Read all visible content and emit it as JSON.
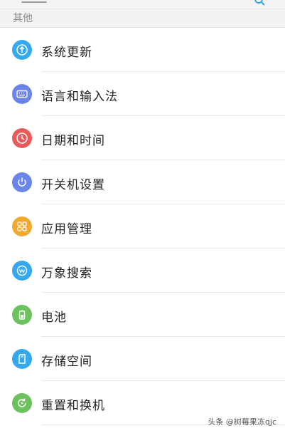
{
  "section": {
    "title": "其他"
  },
  "items": [
    {
      "label": "系统更新",
      "icon": "update-arrow-icon",
      "color": "#36a8ee"
    },
    {
      "label": "语言和输入法",
      "icon": "keyboard-icon",
      "color": "#6b86e8"
    },
    {
      "label": "日期和时间",
      "icon": "clock-icon",
      "color": "#ea5a5a"
    },
    {
      "label": "开关机设置",
      "icon": "power-icon",
      "color": "#6b86e8"
    },
    {
      "label": "应用管理",
      "icon": "grid-icon",
      "color": "#f2a831"
    },
    {
      "label": "万象搜索",
      "icon": "globe-search-icon",
      "color": "#36a8ee"
    },
    {
      "label": "电池",
      "icon": "battery-icon",
      "color": "#6cc25c"
    },
    {
      "label": "存储空间",
      "icon": "sd-card-icon",
      "color": "#36a8ee"
    },
    {
      "label": "重置和换机",
      "icon": "reset-icon",
      "color": "#6cc25c"
    }
  ],
  "watermark": "头条 @树莓果冻qjc"
}
